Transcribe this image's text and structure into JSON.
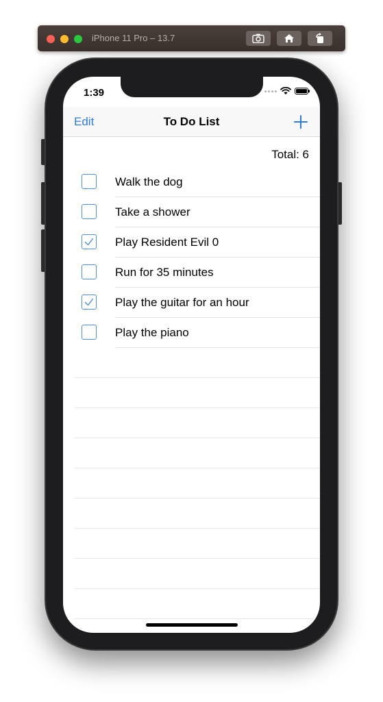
{
  "simulator": {
    "title": "iPhone 11 Pro – 13.7",
    "buttons": [
      "screenshot-icon",
      "home-icon",
      "rotate-icon"
    ]
  },
  "status_bar": {
    "time": "1:39",
    "icons": [
      "signal-icon",
      "wifi-icon",
      "battery-icon"
    ]
  },
  "navbar": {
    "left_label": "Edit",
    "title": "To Do List",
    "right_icon": "plus-icon"
  },
  "total_label": "Total: 6",
  "todos": [
    {
      "label": "Walk the dog",
      "checked": false
    },
    {
      "label": "Take a shower",
      "checked": false
    },
    {
      "label": "Play Resident Evil 0",
      "checked": true
    },
    {
      "label": "Run for 35 minutes",
      "checked": false
    },
    {
      "label": "Play the guitar for an hour",
      "checked": true
    },
    {
      "label": "Play the piano",
      "checked": false
    }
  ],
  "colors": {
    "accent": "#2f7bd9",
    "checkbox_border": "#4a8fdc"
  }
}
